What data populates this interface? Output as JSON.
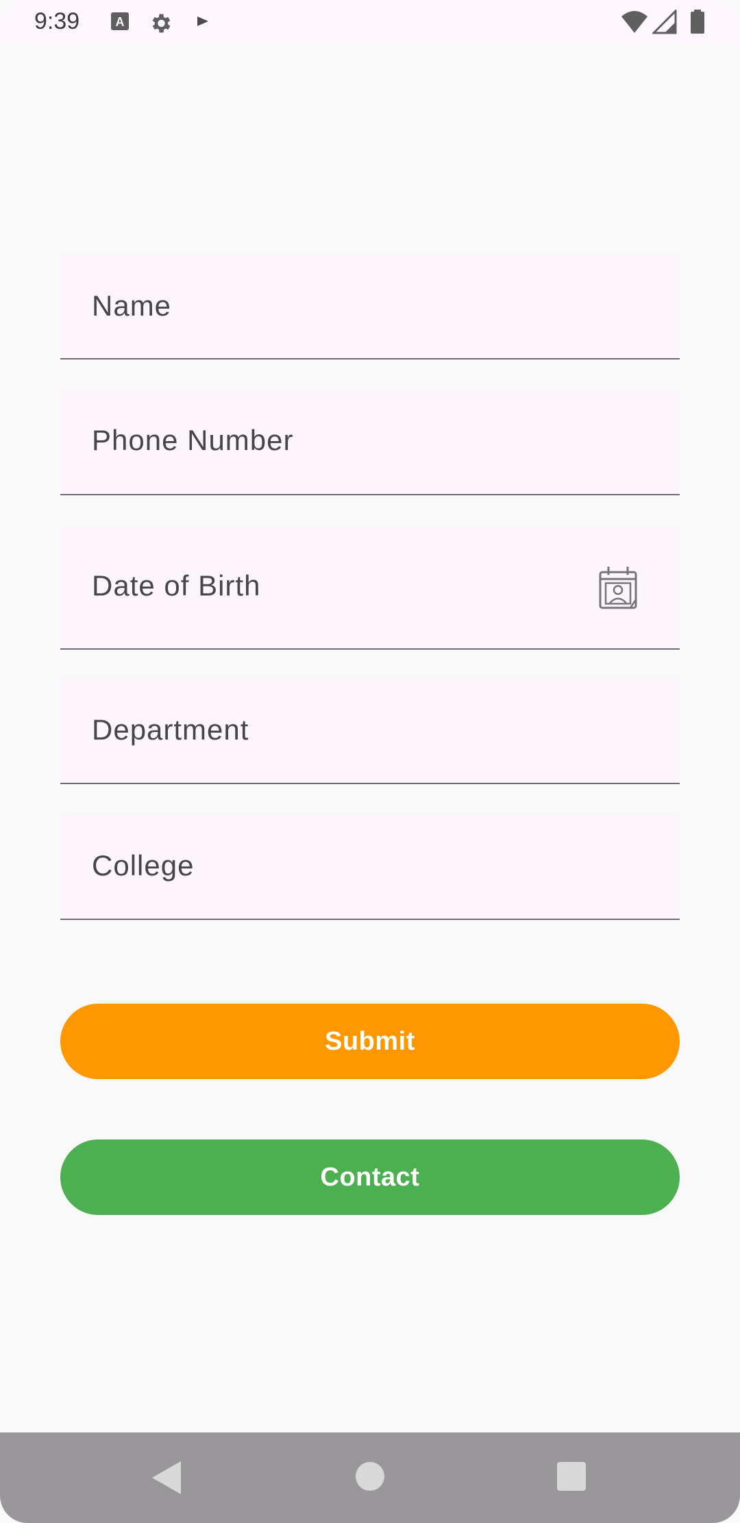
{
  "status_bar": {
    "time": "9:39",
    "icons": [
      "text-a-icon",
      "gear-icon",
      "play-icon",
      "wifi-icon",
      "cell-signal-icon",
      "battery-icon"
    ]
  },
  "form": {
    "fields": [
      {
        "label": "Name"
      },
      {
        "label": "Phone Number"
      },
      {
        "label": "Date of Birth",
        "trailing_icon": "calendar-icon"
      },
      {
        "label": "Department"
      },
      {
        "label": "College"
      }
    ]
  },
  "buttons": {
    "submit_label": "Submit",
    "contact_label": "Contact"
  },
  "colors": {
    "submit": "#ff9800",
    "contact": "#4caf50",
    "field_background": "#fcf6fc",
    "nav_bar": "#9a979b"
  },
  "nav_bar": {
    "icons": [
      "back-icon",
      "home-icon",
      "recents-icon"
    ]
  }
}
